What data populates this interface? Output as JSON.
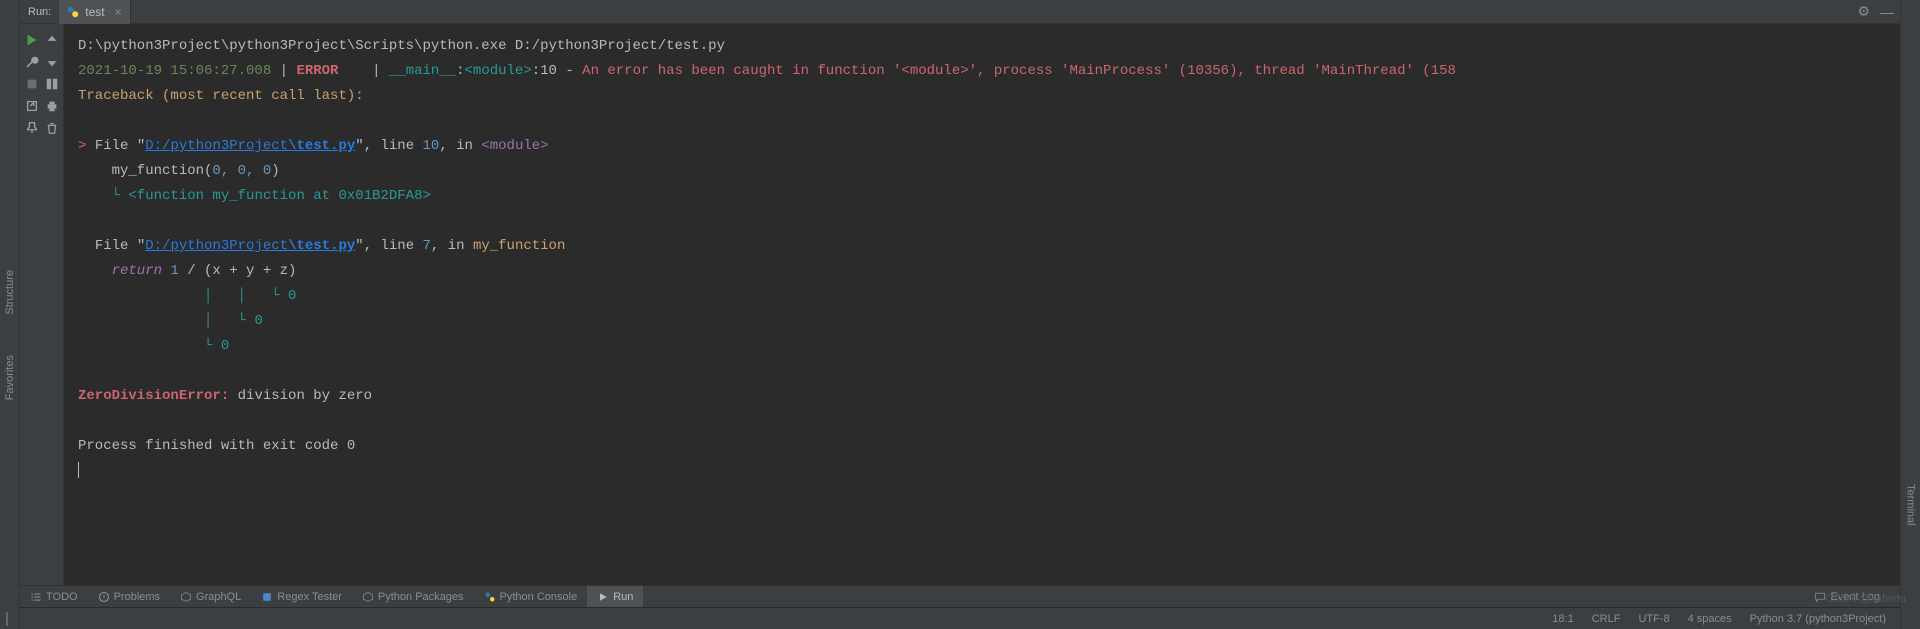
{
  "tabbar": {
    "tool_label": "Run:",
    "tab_name": "test",
    "close_glyph": "×",
    "gear_glyph": "⚙",
    "hide_glyph": "—"
  },
  "left_rail": {
    "structure": "Structure",
    "favorites": "Favorites"
  },
  "right_rail": {
    "terminal": "Terminal"
  },
  "console": {
    "cmd": "D:\\python3Project\\python3Project\\Scripts\\python.exe D:/python3Project/test.py",
    "timestamp": "2021-10-19 15:06:27.008",
    "pipe": " | ",
    "level": "ERROR",
    "pipe2": "    | ",
    "module": "__main__",
    "colon": ":",
    "angle_module": "<module>",
    "lineno": ":10",
    "dash": " - ",
    "errmsg": "An error has been caught in function '<module>', process 'MainProcess' (10356), thread 'MainThread' (158",
    "traceback": "Traceback (most recent call last):",
    "frame1": {
      "prefix": "> ",
      "file_word": "File \"",
      "path_a": "D:/python3Project",
      "path_b": "\\test.py",
      "quote": "\"",
      "comma": ", ",
      "line_word": "line ",
      "line_num": "10",
      "in_word": ", in ",
      "scope": "<module>",
      "code": "    my_function(",
      "args": "0, 0, 0",
      "close": ")",
      "anno_prefix": "    └ ",
      "anno": "<function my_function at 0x01B2DFA8>"
    },
    "frame2": {
      "prefix": "  ",
      "file_word": "File \"",
      "path_a": "D:/python3Project",
      "path_b": "\\test.py",
      "quote": "\"",
      "comma": ", ",
      "line_word": "line ",
      "line_num": "7",
      "in_word": ", in ",
      "scope": "my_function",
      "code_ret": "    return ",
      "one": "1",
      "expr": " / (x + y + z)",
      "tree1": "               │   │   └ ",
      "z1": "0",
      "tree2": "               │   └ ",
      "z2": "0",
      "tree3": "               └ ",
      "z3": "0"
    },
    "exc_name": "ZeroDivisionError:",
    "exc_msg": " division by zero",
    "exit": "Process finished with exit code 0"
  },
  "bottom_bar": {
    "todo": "TODO",
    "problems": "Problems",
    "graphql": "GraphQL",
    "regex": "Regex Tester",
    "pypkg": "Python Packages",
    "pyconsole": "Python Console",
    "run": "Run",
    "eventlog": "Event Log"
  },
  "status_bar": {
    "pos": "18:1",
    "eol": "CRLF",
    "enc": "UTF-8",
    "indent": "4 spaces",
    "interp": "Python 3.7 (python3Project)"
  },
  "watermark": "CSDN @safvirtu"
}
